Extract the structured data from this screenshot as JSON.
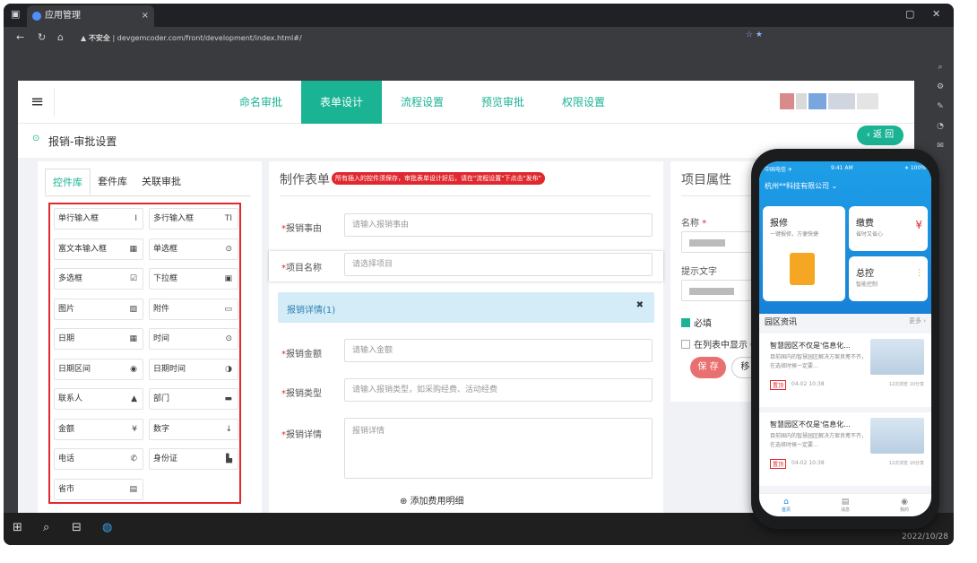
{
  "browser": {
    "tab_title": "应用管理",
    "tab_close": "×",
    "url_warning": "▲ 不安全",
    "url": "devgemcoder.com/front/development/index.html#/",
    "win_min": "–",
    "win_max": "▢",
    "win_close": "✕"
  },
  "topnav": {
    "tabs": [
      {
        "label": "命名审批"
      },
      {
        "label": "表单设计"
      },
      {
        "label": "流程设置"
      },
      {
        "label": "预览审批"
      },
      {
        "label": "权限设置"
      }
    ],
    "active_index": 1,
    "accent": "#1ab394"
  },
  "subhead": {
    "title": "报销-审批设置",
    "back_label": "返 回"
  },
  "left": {
    "tabs": [
      "控件库",
      "套件库",
      "关联审批"
    ],
    "controls": [
      {
        "label": "单行输入框",
        "icon": "I"
      },
      {
        "label": "多行输入框",
        "icon": "TI"
      },
      {
        "label": "富文本输入框",
        "icon": "▦"
      },
      {
        "label": "单选框",
        "icon": "⊙"
      },
      {
        "label": "多选框",
        "icon": "☑"
      },
      {
        "label": "下拉框",
        "icon": "▣"
      },
      {
        "label": "图片",
        "icon": "▨"
      },
      {
        "label": "附件",
        "icon": "▭"
      },
      {
        "label": "日期",
        "icon": "▦"
      },
      {
        "label": "时间",
        "icon": "⊙"
      },
      {
        "label": "日期区间",
        "icon": "◉"
      },
      {
        "label": "日期时间",
        "icon": "◑"
      },
      {
        "label": "联系人",
        "icon": "▲"
      },
      {
        "label": "部门",
        "icon": "▬"
      },
      {
        "label": "金额",
        "icon": "¥"
      },
      {
        "label": "数字",
        "icon": "↓"
      },
      {
        "label": "电话",
        "icon": "✆"
      },
      {
        "label": "身份证",
        "icon": "▙"
      },
      {
        "label": "省市",
        "icon": "▤"
      }
    ]
  },
  "middle": {
    "title": "制作表单",
    "note": "所有插入的控件须保存，审批表单设计好后，请在\"流程设置\"下点击\"发布\"",
    "fields": [
      {
        "label": "报销事由",
        "placeholder": "请输入报销事由"
      },
      {
        "label": "项目名称",
        "placeholder": "请选择项目"
      }
    ],
    "subtable": {
      "label": "报销详情(1)",
      "close": "✖"
    },
    "detail_fields": [
      {
        "label": "报销金额",
        "placeholder": "请输入金额"
      },
      {
        "label": "报销类型",
        "placeholder": "请输入报销类型，如采购经费、活动经费"
      }
    ],
    "textarea": {
      "label": "报销详情",
      "placeholder": "报销详情"
    },
    "add_detail": "⊕ 添加费用明细"
  },
  "right": {
    "title": "项目属性",
    "name_label": "名称",
    "hint_label": "提示文字",
    "required_label": "必填",
    "required_checked": true,
    "show_in_list_label": "在列表中显示",
    "show_in_list_checked": false,
    "save_label": "保 存",
    "remove_label": "移 除"
  },
  "taskbar": {
    "date": "2022/10/28"
  },
  "phone": {
    "status_left": "中国电信 ✈",
    "status_time": "9:41 AM",
    "status_right": "∗ 100%",
    "company": "杭州**科技有限公司",
    "cards": [
      {
        "title": "报修",
        "sub": "一键报修，方便快捷"
      },
      {
        "title": "缴费",
        "sub": "省时又省心"
      },
      {
        "title": "总控",
        "sub": "智能控制"
      }
    ],
    "news_header": "园区资讯",
    "news_more": "更多 ›",
    "news": [
      {
        "title": "智慧园区不仅是'信息化...",
        "desc": "目前国内的智慧园区解决方案良莠不齐，在选择时候一定要...",
        "tag": "置顶",
        "date": "04-02 10:38",
        "stats": "12次浏览  10分享"
      },
      {
        "title": "智慧园区不仅是'信息化...",
        "desc": "目前国内的智慧园区解决方案良莠不齐，在选择时候一定要...",
        "tag": "置顶",
        "date": "04-02 10:38",
        "stats": "12次浏览  10分享"
      }
    ],
    "tabbar": [
      {
        "label": "首页",
        "icon": "⌂"
      },
      {
        "label": "消息",
        "icon": "▤"
      },
      {
        "label": "我的",
        "icon": "◉"
      }
    ]
  }
}
